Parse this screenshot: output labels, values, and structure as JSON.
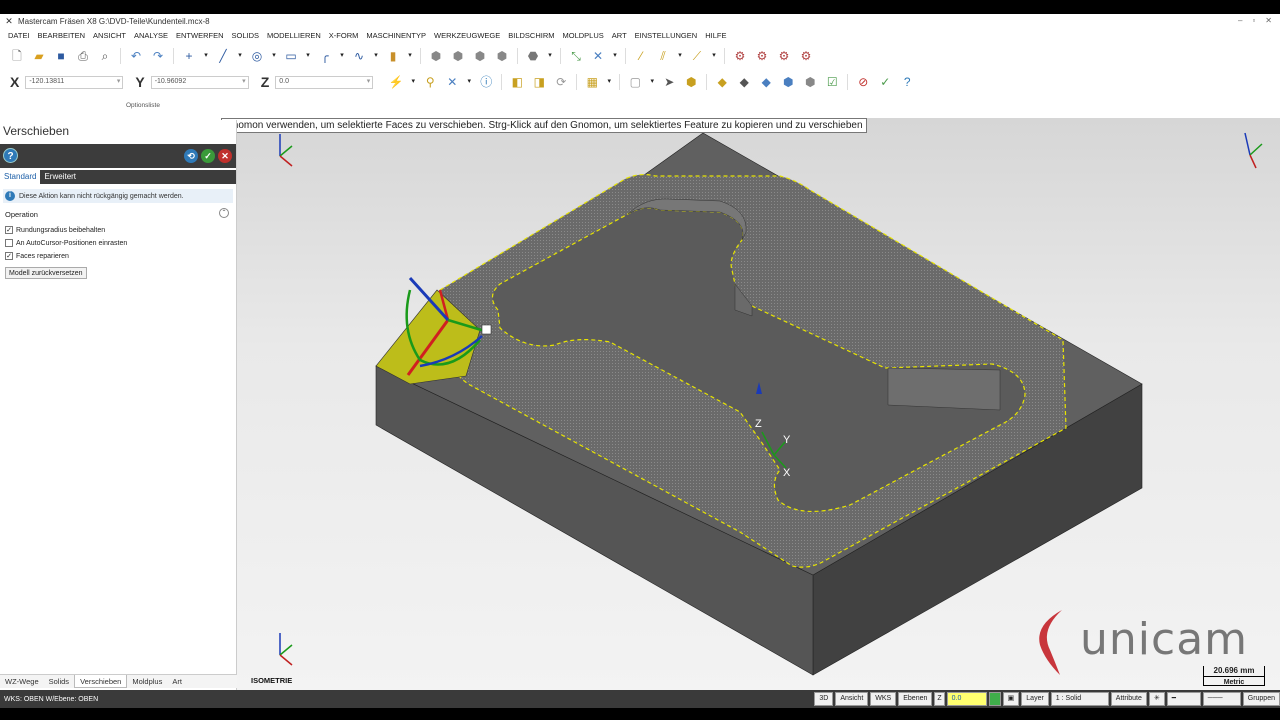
{
  "window": {
    "title": "Mastercam Fräsen X8  G:\\DVD-Teile\\Kundenteil.mcx-8",
    "controls": [
      "–",
      "▫",
      "✕"
    ]
  },
  "menu": [
    "DATEI",
    "BEARBEITEN",
    "ANSICHT",
    "ANALYSE",
    "ENTWERFEN",
    "SOLIDS",
    "MODELLIEREN",
    "X-FORM",
    "MASCHINENTYP",
    "WERKZEUGWEGE",
    "BILDSCHIRM",
    "MOLDPLUS",
    "ART",
    "EINSTELLUNGEN",
    "HILFE"
  ],
  "coords": {
    "x_label": "X",
    "x_value": "-120.13811",
    "y_label": "Y",
    "y_value": "-10.96092",
    "z_label": "Z",
    "z_value": "0.0"
  },
  "options_label": "Optionsliste",
  "tooltip": "Gnomon verwenden, um selektierte Faces zu verschieben. Strg-Klick auf den Gnomon, um selektiertes Feature zu kopieren und zu verschieben",
  "panel": {
    "title": "Verschieben",
    "help": "?",
    "tabs": [
      "Standard",
      "Erweitert"
    ],
    "info": "Diese Aktion kann nicht rückgängig gemacht werden.",
    "section": "Operation",
    "options": [
      {
        "label": "Rundungsradius beibehalten",
        "checked": true
      },
      {
        "label": "An AutoCursor-Positionen einrasten",
        "checked": false
      },
      {
        "label": "Faces reparieren",
        "checked": true
      }
    ],
    "reset_button": "Modell zurückversetzen",
    "bottom_tabs": [
      "WZ-Wege",
      "Solids",
      "Verschieben",
      "Moldplus",
      "Art"
    ],
    "active_bottom_tab": "Verschieben"
  },
  "viewport": {
    "view_label": "ISOMETRIE",
    "scale_value": "20.696 mm",
    "scale_unit": "Metric",
    "logo_text": "unicam",
    "axis_labels": {
      "x": "X",
      "y": "Y",
      "z": "Z"
    }
  },
  "status": {
    "wcs": "WKS: OBEN  W/Ebene: OBEN",
    "buttons": [
      "3D",
      "Ansicht",
      "WKS",
      "Ebenen"
    ],
    "z_label": "Z",
    "z_value": "0.0",
    "layer_label": "Layer",
    "layer_value": "1 : Solid",
    "attribute": "Attribute",
    "groups": "Gruppen"
  },
  "colors": {
    "part_top": "#606060",
    "part_side_left": "#555555",
    "part_side_front": "#414141",
    "selection": "#e7e400",
    "logo_red": "#c8363c"
  }
}
